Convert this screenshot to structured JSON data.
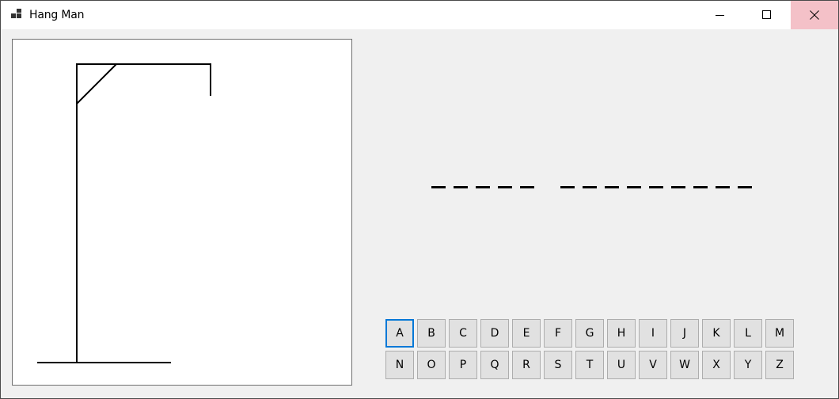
{
  "window": {
    "title": "Hang Man",
    "controls": {
      "minimize": "minimize-icon",
      "maximize": "maximize-icon",
      "close": "close-icon"
    }
  },
  "word": {
    "groups": [
      5,
      9
    ]
  },
  "keyboard": {
    "rows": [
      [
        "A",
        "B",
        "C",
        "D",
        "E",
        "F",
        "G",
        "H",
        "I",
        "J",
        "K",
        "L",
        "M"
      ],
      [
        "N",
        "O",
        "P",
        "Q",
        "R",
        "S",
        "T",
        "U",
        "V",
        "W",
        "X",
        "Y",
        "Z"
      ]
    ],
    "focused": "A"
  },
  "colors": {
    "close_hover": "#f4c1c8",
    "focus_border": "#0078d7",
    "key_bg": "#e1e1e1",
    "panel_bg": "#ffffff",
    "window_bg": "#f0f0f0"
  }
}
